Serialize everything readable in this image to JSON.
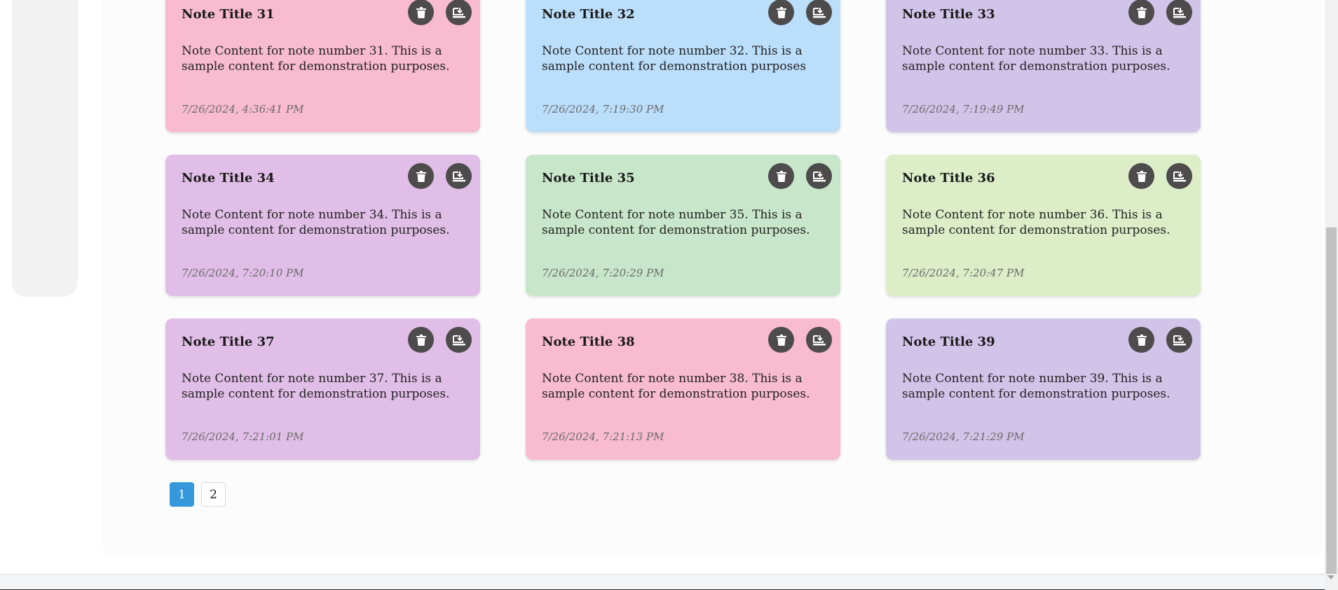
{
  "colors": {
    "pink": "#f8bbd0",
    "blue": "#bbdefb",
    "lavender": "#d1c4e9",
    "orchid": "#e1bee7",
    "green": "#c8e6c9",
    "lime": "#dcedc8",
    "button_dark": "#4d4b4b",
    "page_active": "#3498db"
  },
  "notes": [
    {
      "title": "Note Title 31",
      "content": "Note Content for note number 31. This is a sample content for demonstration purposes.",
      "date": "7/26/2024, 4:36:41 PM",
      "color": "#f8bbd0",
      "delete_icon": "trash-icon",
      "save_icon": "download-icon"
    },
    {
      "title": "Note Title 32",
      "content": "Note Content for note number 32. This is a sample content for demonstration purposes",
      "date": "7/26/2024, 7:19:30 PM",
      "color": "#bbdefb",
      "delete_icon": "trash-icon",
      "save_icon": "download-icon"
    },
    {
      "title": "Note Title 33",
      "content": "Note Content for note number 33. This is a sample content for demonstration purposes.",
      "date": "7/26/2024, 7:19:49 PM",
      "color": "#d1c4e9",
      "delete_icon": "trash-icon",
      "save_icon": "download-icon"
    },
    {
      "title": "Note Title 34",
      "content": "Note Content for note number 34. This is a sample content for demonstration purposes.",
      "date": "7/26/2024, 7:20:10 PM",
      "color": "#e1bee7",
      "delete_icon": "trash-icon",
      "save_icon": "download-icon"
    },
    {
      "title": "Note Title 35",
      "content": "Note Content for note number 35. This is a sample content for demonstration purposes.",
      "date": "7/26/2024, 7:20:29 PM",
      "color": "#c8e6c9",
      "delete_icon": "trash-icon",
      "save_icon": "download-icon"
    },
    {
      "title": "Note Title 36",
      "content": "Note Content for note number 36. This is a sample content for demonstration purposes.",
      "date": "7/26/2024, 7:20:47 PM",
      "color": "#dcedc8",
      "delete_icon": "trash-icon",
      "save_icon": "download-icon"
    },
    {
      "title": "Note Title 37",
      "content": "Note Content for note number 37. This is a sample content for demonstration purposes.",
      "date": "7/26/2024, 7:21:01 PM",
      "color": "#e1bee7",
      "delete_icon": "trash-icon",
      "save_icon": "download-icon"
    },
    {
      "title": "Note Title 38",
      "content": "Note Content for note number 38. This is a sample content for demonstration purposes.",
      "date": "7/26/2024, 7:21:13 PM",
      "color": "#f8bbd0",
      "delete_icon": "trash-icon",
      "save_icon": "download-icon"
    },
    {
      "title": "Note Title 39",
      "content": "Note Content for note number 39. This is a sample content for demonstration purposes.",
      "date": "7/26/2024, 7:21:29 PM",
      "color": "#d1c4e9",
      "delete_icon": "trash-icon",
      "save_icon": "download-icon"
    }
  ],
  "pagination": {
    "pages": [
      "1",
      "2"
    ],
    "current": "1"
  }
}
